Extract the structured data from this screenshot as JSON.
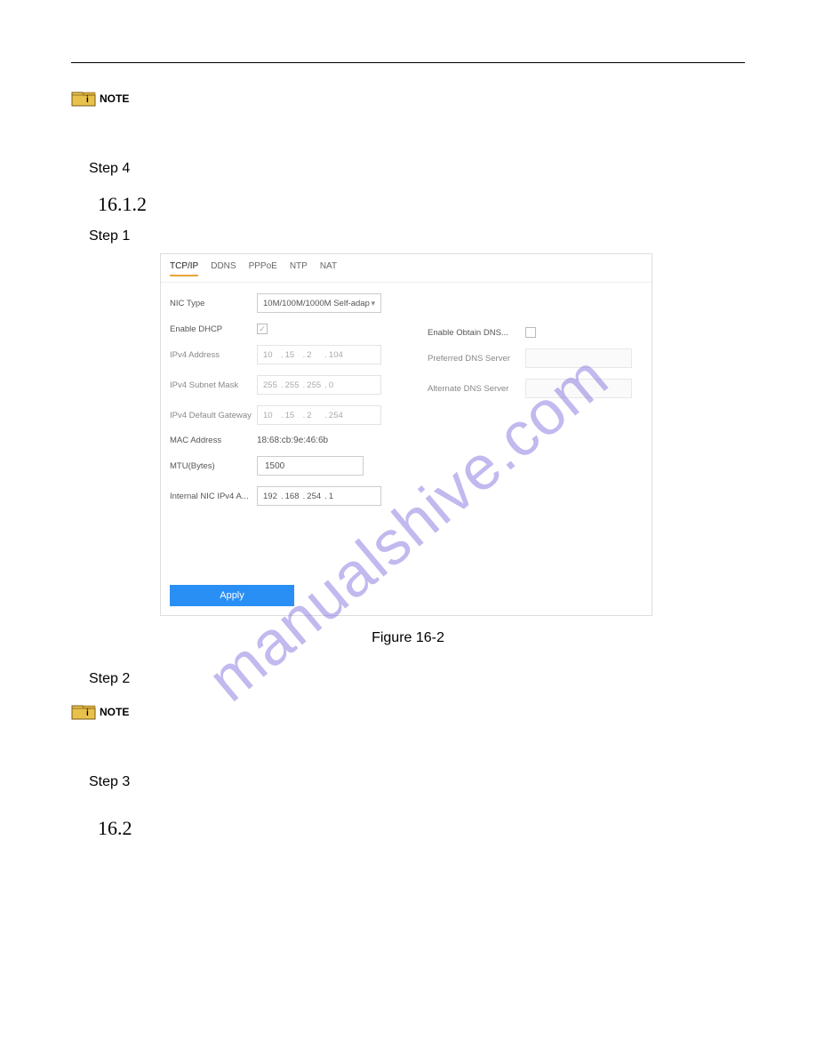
{
  "watermark": "manualshive.com",
  "note_label": "NOTE",
  "step4": "Step 4",
  "section_1612": "16.1.2",
  "step1": "Step 1",
  "panel": {
    "tabs": [
      "TCP/IP",
      "DDNS",
      "PPPoE",
      "NTP",
      "NAT"
    ],
    "nic_type_label": "NIC Type",
    "nic_type_value": "10M/100M/1000M Self-adap",
    "enable_dhcp_label": "Enable DHCP",
    "enable_dhcp_checked": "✓",
    "ipv4_addr_label": "IPv4 Address",
    "ipv4_addr": [
      "10",
      "15",
      "2",
      "104"
    ],
    "ipv4_mask_label": "IPv4 Subnet Mask",
    "ipv4_mask": [
      "255",
      "255",
      "255",
      "0"
    ],
    "ipv4_gw_label": "IPv4 Default Gateway",
    "ipv4_gw": [
      "10",
      "15",
      "2",
      "254"
    ],
    "mac_label": "MAC Address",
    "mac_value": "18:68:cb:9e:46:6b",
    "mtu_label": "MTU(Bytes)",
    "mtu_value": "1500",
    "internal_nic_label": "Internal NIC IPv4 A...",
    "internal_nic": [
      "192",
      "168",
      "254",
      "1"
    ],
    "enable_obtain_dns_label": "Enable Obtain DNS...",
    "pref_dns_label": "Preferred DNS Server",
    "alt_dns_label": "Alternate DNS Server",
    "apply_label": "Apply"
  },
  "figure_caption": "Figure 16-2",
  "step2": "Step 2",
  "step3": "Step 3",
  "section_162": "16.2"
}
